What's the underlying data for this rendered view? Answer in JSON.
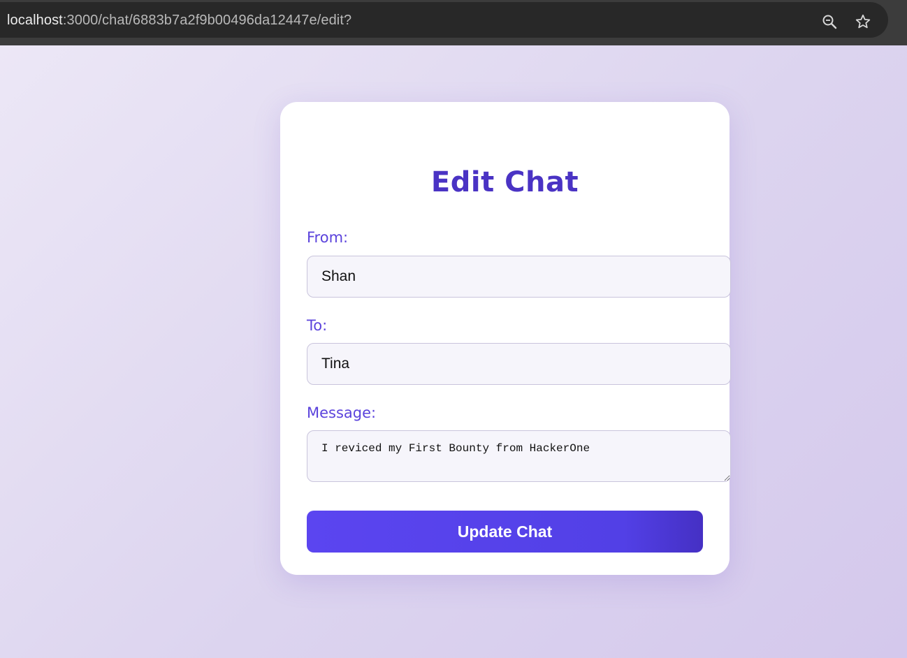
{
  "browser": {
    "url_host": "localhost",
    "url_path": ":3000/chat/6883b7a2f9b00496da12447e/edit?",
    "icons": [
      "zoom-icon",
      "bookmark-star-icon"
    ]
  },
  "form": {
    "title": "Edit Chat",
    "from_label": "From:",
    "from_value": "Shan",
    "to_label": "To:",
    "to_value": "Tina",
    "message_label": "Message:",
    "message_value": "I reviced my First Bounty from HackerOne",
    "submit_label": "Update Chat"
  },
  "colors": {
    "accent": "#5b45f0",
    "title": "#4a33c4",
    "label": "#5b43dc"
  }
}
